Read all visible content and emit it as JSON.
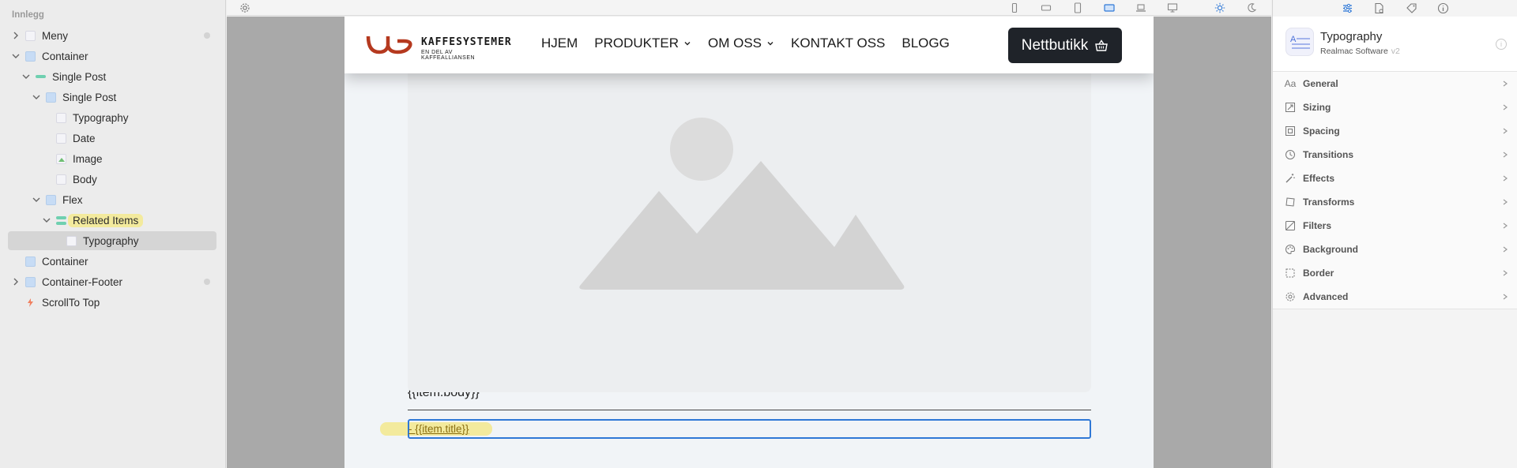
{
  "navigator": {
    "title": "Innlegg",
    "items": [
      {
        "label": "Meny"
      },
      {
        "label": "Container"
      },
      {
        "label": "Single Post"
      },
      {
        "label": "Single Post"
      },
      {
        "label": "Typography"
      },
      {
        "label": "Date"
      },
      {
        "label": "Image"
      },
      {
        "label": "Body"
      },
      {
        "label": "Flex"
      },
      {
        "label": "Related Items"
      },
      {
        "label": "Typography"
      },
      {
        "label": "Container"
      },
      {
        "label": "Container-Footer"
      },
      {
        "label": "ScrollTo Top"
      }
    ]
  },
  "toolbar": {
    "icons": [
      "gear-icon",
      "phone-portrait-icon",
      "phone-landscape-icon",
      "tablet-portrait-icon",
      "tablet-landscape-icon",
      "laptop-icon",
      "desktop-icon",
      "light-mode-icon",
      "dark-mode-icon"
    ],
    "active_device": "tablet-landscape-icon",
    "accent_color": "#2f78d6"
  },
  "site": {
    "logo_text": "KAFFESYSTEMER",
    "logo_sub": "EN DEL AV KAFFEALLIANSEN",
    "brand_color": "#b5391f",
    "nav": [
      {
        "label": "HJEM",
        "has_dropdown": false
      },
      {
        "label": "PRODUKTER",
        "has_dropdown": true
      },
      {
        "label": "OM OSS",
        "has_dropdown": true
      },
      {
        "label": "KONTAKT OSS",
        "has_dropdown": false
      },
      {
        "label": "BLOGG",
        "has_dropdown": false
      }
    ],
    "shop_button": "Nettbutikk",
    "body_placeholder": "{{item.body}}",
    "title_placeholder": "- {{item.title}}"
  },
  "inspector": {
    "tabs": [
      "sliders-icon",
      "document-gear-icon",
      "tag-icon",
      "info-icon"
    ],
    "component_name": "Typography",
    "vendor": "Realmac Software",
    "version": "v2",
    "sections": [
      {
        "label": "General",
        "icon": "type-icon",
        "icon_text": "Aa"
      },
      {
        "label": "Sizing",
        "icon": "resize-icon"
      },
      {
        "label": "Spacing",
        "icon": "spacing-icon"
      },
      {
        "label": "Transitions",
        "icon": "transitions-icon"
      },
      {
        "label": "Effects",
        "icon": "magic-wand-icon"
      },
      {
        "label": "Transforms",
        "icon": "transform-icon"
      },
      {
        "label": "Filters",
        "icon": "filter-icon"
      },
      {
        "label": "Background",
        "icon": "palette-icon"
      },
      {
        "label": "Border",
        "icon": "border-icon"
      },
      {
        "label": "Advanced",
        "icon": "gear-icon"
      }
    ]
  }
}
